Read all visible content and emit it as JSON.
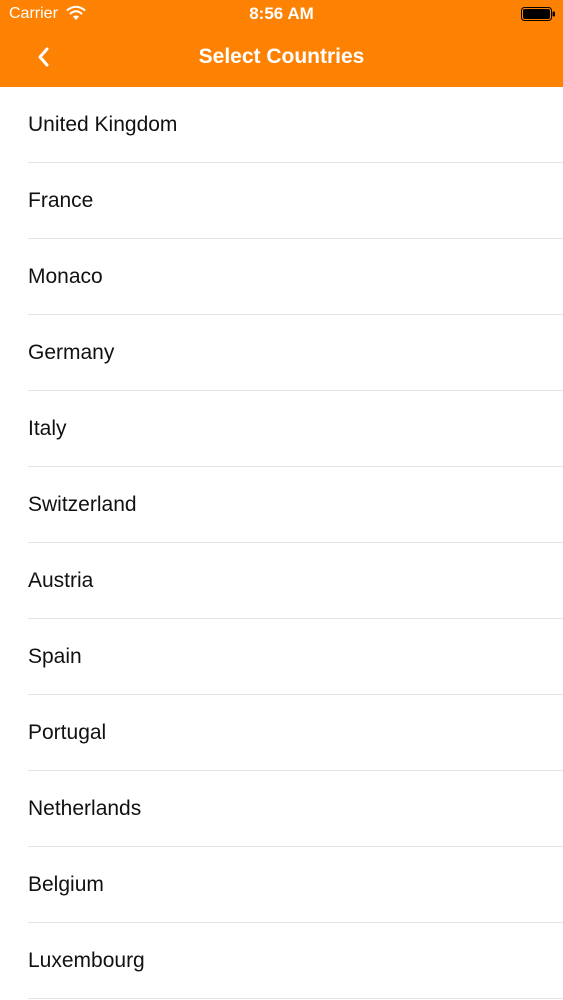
{
  "status_bar": {
    "carrier": "Carrier",
    "time": "8:56 AM",
    "wifi_icon": "wifi-icon",
    "battery_icon": "battery-icon"
  },
  "nav": {
    "title": "Select Countries",
    "back_icon": "chevron-left-icon"
  },
  "countries": [
    "United Kingdom",
    "France",
    "Monaco",
    "Germany",
    "Italy",
    "Switzerland",
    "Austria",
    "Spain",
    "Portugal",
    "Netherlands",
    "Belgium",
    "Luxembourg"
  ],
  "colors": {
    "accent": "#fd8203",
    "separator": "#e3e3e3",
    "text": "#111111"
  }
}
